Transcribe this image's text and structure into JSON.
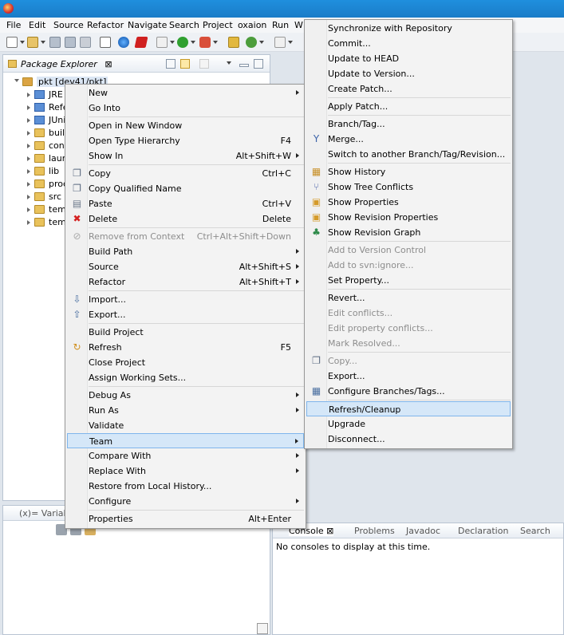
{
  "menubar": {
    "items": [
      "File",
      "Edit",
      "Source",
      "Refactor",
      "Navigate",
      "Search",
      "Project",
      "oxaion",
      "Run",
      "W"
    ]
  },
  "package_explorer": {
    "title": "Package Explorer",
    "close_glyph": "⊠",
    "tree": [
      {
        "label": "pkt [dev41/pkt]",
        "icon": "project-icon"
      },
      {
        "label": "JRE S",
        "icon": "library-icon"
      },
      {
        "label": "Refe",
        "icon": "library-icon"
      },
      {
        "label": "JUni",
        "icon": "library-icon"
      },
      {
        "label": "buil",
        "icon": "folder-icon"
      },
      {
        "label": "cont",
        "icon": "folder-icon"
      },
      {
        "label": "laun",
        "icon": "folder-icon"
      },
      {
        "label": "lib",
        "icon": "folder-icon"
      },
      {
        "label": "proc",
        "icon": "folder-icon"
      },
      {
        "label": "src",
        "icon": "folder-icon"
      },
      {
        "label": "tem",
        "icon": "folder-icon"
      },
      {
        "label": "tem",
        "icon": "folder-icon"
      }
    ]
  },
  "variables_view": {
    "title": "(x)= Variables"
  },
  "console_view": {
    "tabs": [
      "Console",
      "Problems",
      "Javadoc",
      "Declaration",
      "Search"
    ],
    "close_glyph": "⊠",
    "message": "No consoles to display at this time."
  },
  "context_menu": {
    "items": [
      {
        "label": "New",
        "submenu": true
      },
      {
        "label": "Go Into"
      },
      {
        "sep": true
      },
      {
        "label": "Open in New Window"
      },
      {
        "label": "Open Type Hierarchy",
        "accel": "F4"
      },
      {
        "label": "Show In",
        "accel": "Alt+Shift+W",
        "submenu": true
      },
      {
        "sep": true
      },
      {
        "label": "Copy",
        "accel": "Ctrl+C",
        "icon": "copy-icon"
      },
      {
        "label": "Copy Qualified Name",
        "icon": "copy-qualified-icon"
      },
      {
        "label": "Paste",
        "accel": "Ctrl+V",
        "icon": "paste-icon"
      },
      {
        "label": "Delete",
        "accel": "Delete",
        "icon": "delete-icon"
      },
      {
        "sep": true
      },
      {
        "label": "Remove from Context",
        "accel": "Ctrl+Alt+Shift+Down",
        "disabled": true,
        "icon": "remove-context-icon"
      },
      {
        "label": "Build Path",
        "submenu": true
      },
      {
        "label": "Source",
        "accel": "Alt+Shift+S",
        "submenu": true
      },
      {
        "label": "Refactor",
        "accel": "Alt+Shift+T",
        "submenu": true
      },
      {
        "sep": true
      },
      {
        "label": "Import...",
        "icon": "import-icon"
      },
      {
        "label": "Export...",
        "icon": "export-icon"
      },
      {
        "sep": true
      },
      {
        "label": "Build Project"
      },
      {
        "label": "Refresh",
        "accel": "F5",
        "icon": "refresh-icon"
      },
      {
        "label": "Close Project"
      },
      {
        "label": "Assign Working Sets..."
      },
      {
        "sep": true
      },
      {
        "label": "Debug As",
        "submenu": true
      },
      {
        "label": "Run As",
        "submenu": true
      },
      {
        "label": "Validate"
      },
      {
        "label": "Team",
        "submenu": true,
        "highlight": true
      },
      {
        "label": "Compare With",
        "submenu": true
      },
      {
        "label": "Replace With",
        "submenu": true
      },
      {
        "label": "Restore from Local History..."
      },
      {
        "label": "Configure",
        "submenu": true
      },
      {
        "sep": true
      },
      {
        "label": "Properties",
        "accel": "Alt+Enter"
      }
    ]
  },
  "team_menu": {
    "items": [
      {
        "label": "Synchronize with Repository"
      },
      {
        "label": "Commit..."
      },
      {
        "label": "Update to HEAD"
      },
      {
        "label": "Update to Version..."
      },
      {
        "label": "Create Patch..."
      },
      {
        "sep": true
      },
      {
        "label": "Apply Patch..."
      },
      {
        "sep": true
      },
      {
        "label": "Branch/Tag..."
      },
      {
        "label": "Merge...",
        "icon": "merge-icon"
      },
      {
        "label": "Switch to another Branch/Tag/Revision..."
      },
      {
        "sep": true
      },
      {
        "label": "Show History",
        "icon": "history-icon"
      },
      {
        "label": "Show Tree Conflicts",
        "icon": "tree-conflicts-icon"
      },
      {
        "label": "Show Properties",
        "icon": "properties-icon"
      },
      {
        "label": "Show Revision Properties",
        "icon": "revision-properties-icon"
      },
      {
        "label": "Show Revision Graph",
        "icon": "revision-graph-icon"
      },
      {
        "sep": true
      },
      {
        "label": "Add to Version Control",
        "disabled": true
      },
      {
        "label": "Add to svn:ignore...",
        "disabled": true
      },
      {
        "label": "Set Property..."
      },
      {
        "sep": true
      },
      {
        "label": "Revert..."
      },
      {
        "label": "Edit conflicts...",
        "disabled": true
      },
      {
        "label": "Edit property conflicts...",
        "disabled": true
      },
      {
        "label": "Mark Resolved...",
        "disabled": true
      },
      {
        "sep": true
      },
      {
        "label": "Copy...",
        "disabled": true,
        "icon": "copy-icon"
      },
      {
        "label": "Export..."
      },
      {
        "label": "Configure Branches/Tags...",
        "icon": "configure-branches-icon"
      },
      {
        "sep": true
      },
      {
        "label": "Refresh/Cleanup",
        "highlight": true
      },
      {
        "label": "Upgrade"
      },
      {
        "label": "Disconnect..."
      }
    ]
  }
}
